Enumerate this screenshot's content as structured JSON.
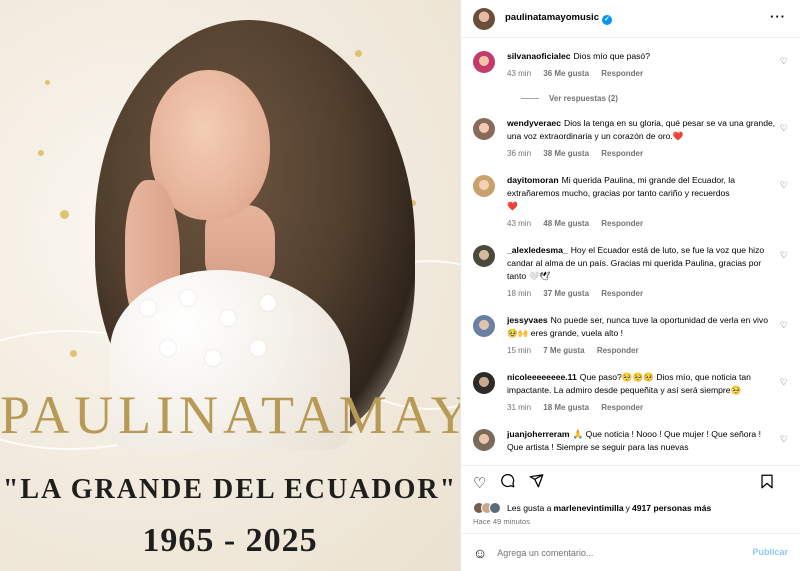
{
  "poster": {
    "title": "PAULINATAMAYO",
    "subtitle": "\"LA GRANDE DEL ECUADOR\"",
    "years": "1965  -  2025"
  },
  "header": {
    "username": "paulinatamayomusic",
    "more_icon": "more-horizontal-icon"
  },
  "comments": [
    {
      "user": "silvanaoficialec",
      "text": "Dios mío que pasó?",
      "time": "43 min",
      "likes": "36 Me gusta",
      "reply": "Responder",
      "view_replies": "Ver respuestas (2)",
      "avatar_color": "#c43a6a"
    },
    {
      "user": "wendyveraec",
      "text": "Dios la tenga en su gloria, qué pesar se va una grande, una voz extraordinaria y un corazón de oro.",
      "emoji": "❤️",
      "time": "36 min",
      "likes": "38 Me gusta",
      "reply": "Responder",
      "avatar_color": "#8a6a5a"
    },
    {
      "user": "dayitomoran",
      "text": "Mi querida Paulina, mi grande del Ecuador, la extrañaremos mucho, gracias por tanto cariño y recuerdos",
      "emoji": "❤️",
      "time": "43 min",
      "likes": "48 Me gusta",
      "reply": "Responder",
      "avatar_color": "#c9a26b"
    },
    {
      "user": "_alexledesma_",
      "text": "Hoy el Ecuador está de luto, se fue la voz que hizo candar al alma de un país. Gracias mi querida Paulina, gracias por tanto",
      "emoji": "🤍🕊",
      "time": "18 min",
      "likes": "37 Me gusta",
      "reply": "Responder",
      "avatar_color": "#4a4a3a"
    },
    {
      "user": "jessyvaes",
      "text": "No puede ser, nunca tuve la oportunidad de verla en vivo",
      "emoji": "🥹🙌",
      "text2": "eres grande, vuela alto !",
      "time": "15 min",
      "likes": "7 Me gusta",
      "reply": "Responder",
      "avatar_color": "#6b7fa3"
    },
    {
      "user": "nicoleeeeeeee.11",
      "text": "Que paso?",
      "emoji": "🥺🥺🥺",
      "text2": "Dios mío, que noticia tan impactante. La admiro desde pequeñita y así será siempre",
      "emoji2": "🥺",
      "time": "31 min",
      "likes": "18 Me gusta",
      "reply": "Responder",
      "avatar_color": "#2e2a2a"
    },
    {
      "user": "juanjoherreram",
      "emoji": "🙏",
      "text": "Que noticia ! Nooo ! Que mujer ! Que señora ! Que artista ! Siempre se seguir para las nuevas",
      "time": "",
      "likes": "",
      "reply": "",
      "avatar_color": "#7a6a5a"
    }
  ],
  "actions": {
    "like_icon": "heart-icon",
    "comment_icon": "comment-icon",
    "share_icon": "share-icon",
    "save_icon": "bookmark-icon"
  },
  "likes": {
    "prefix": "Les gusta a ",
    "user": "marlenevintimilla",
    "middle": " y ",
    "count": "4917 personas más"
  },
  "posted": "Hace 49 minutos",
  "add_comment": {
    "placeholder": "Agrega un comentario...",
    "post_label": "Publicar"
  }
}
